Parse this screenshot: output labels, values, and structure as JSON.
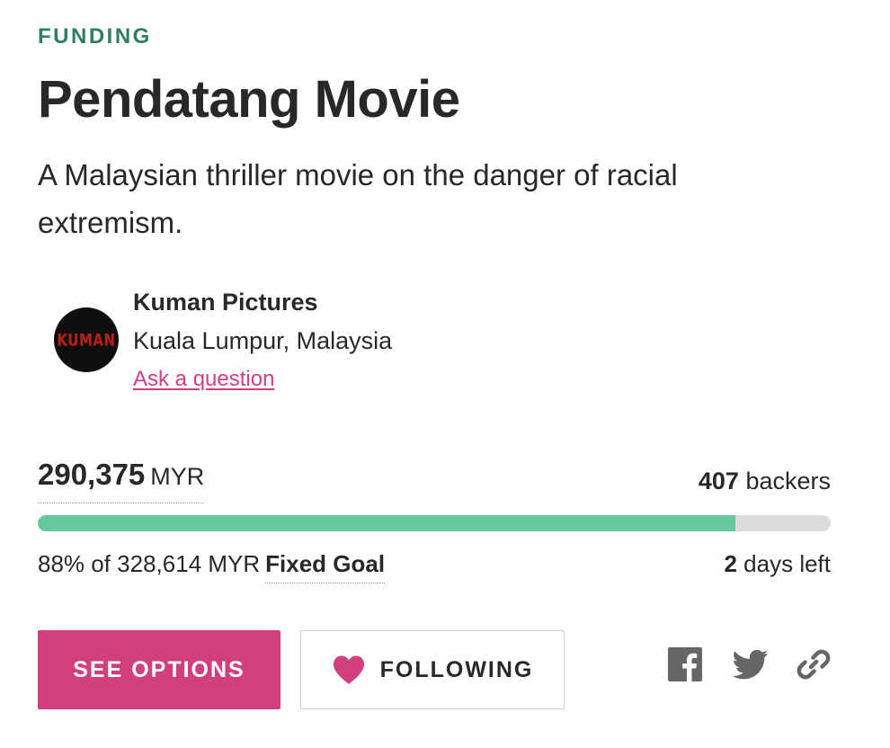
{
  "category": "FUNDING",
  "project": {
    "title": "Pendatang Movie",
    "blurb": "A Malaysian thriller movie on the danger of racial extremism."
  },
  "creator": {
    "name": "Kuman Pictures",
    "location": "Kuala Lumpur, Malaysia",
    "ask_link": "Ask a question",
    "avatar_logo_text": "KUMAN"
  },
  "funding": {
    "pledged_amount": "290,375",
    "currency": "MYR",
    "backers_count": "407",
    "backers_label": "backers",
    "progress_percent": 88,
    "goal_text": "88% of 328,614 MYR",
    "goal_type": "Fixed Goal",
    "days_count": "2",
    "days_label": "days left"
  },
  "actions": {
    "see_options_label": "SEE OPTIONS",
    "following_label": "FOLLOWING"
  },
  "share_icons": [
    "facebook-icon",
    "twitter-icon",
    "link-icon"
  ],
  "colors": {
    "category_green": "#2f7d62",
    "accent_pink": "#d23f7d",
    "link_pink": "#d23f87",
    "progress_green": "#66c89b",
    "progress_track": "#dcdcdc",
    "icon_gray": "#666666",
    "text_dark": "#282828"
  }
}
